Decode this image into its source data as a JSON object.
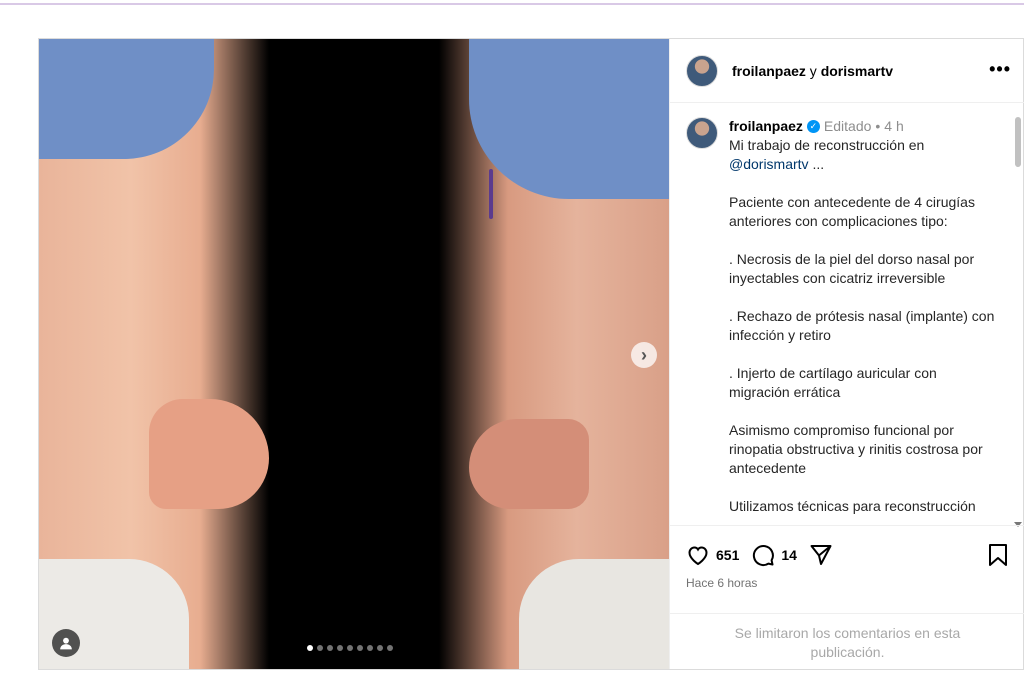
{
  "post": {
    "header": {
      "author": "froilanpaez",
      "connector": "y",
      "collaborator": "dorismartv"
    },
    "caption": {
      "username": "froilanpaez",
      "edited": "Editado",
      "separator": "•",
      "time": "4 h",
      "line1": "Mi trabajo de reconstrucción en",
      "mention": "@dorismartv",
      "ellipsis": "...",
      "paragraphs": [
        "Paciente con antecedente de 4 cirugías anteriores con complicaciones tipo:",
        ". Necrosis de la piel del dorso nasal por inyectables con cicatriz irreversible",
        ". Rechazo de prótesis nasal (implante) con infección y retiro",
        ". Injerto de cartílago auricular con migración errática",
        "Asimismo compromiso funcional por rinopatia obstructiva y rinitis costrosa por antecedente",
        "Utilizamos técnicas para reconstrucción"
      ]
    },
    "likes": "651",
    "comments": "14",
    "timestamp": "Hace 6 horas",
    "comments_limited": "Se limitaron los comentarios en esta publicación.",
    "carousel": {
      "total": 9,
      "active_index": 0
    }
  },
  "icons": {
    "more": "more-horizontal-icon",
    "like": "heart-icon",
    "comment": "comment-icon",
    "share": "send-icon",
    "save": "bookmark-icon",
    "next": "chevron-right-icon",
    "tag": "user-tag-icon",
    "verified": "verified-badge-icon"
  },
  "colors": {
    "link": "#00376b",
    "verified": "#0095f6",
    "muted": "#8e8e8e"
  }
}
